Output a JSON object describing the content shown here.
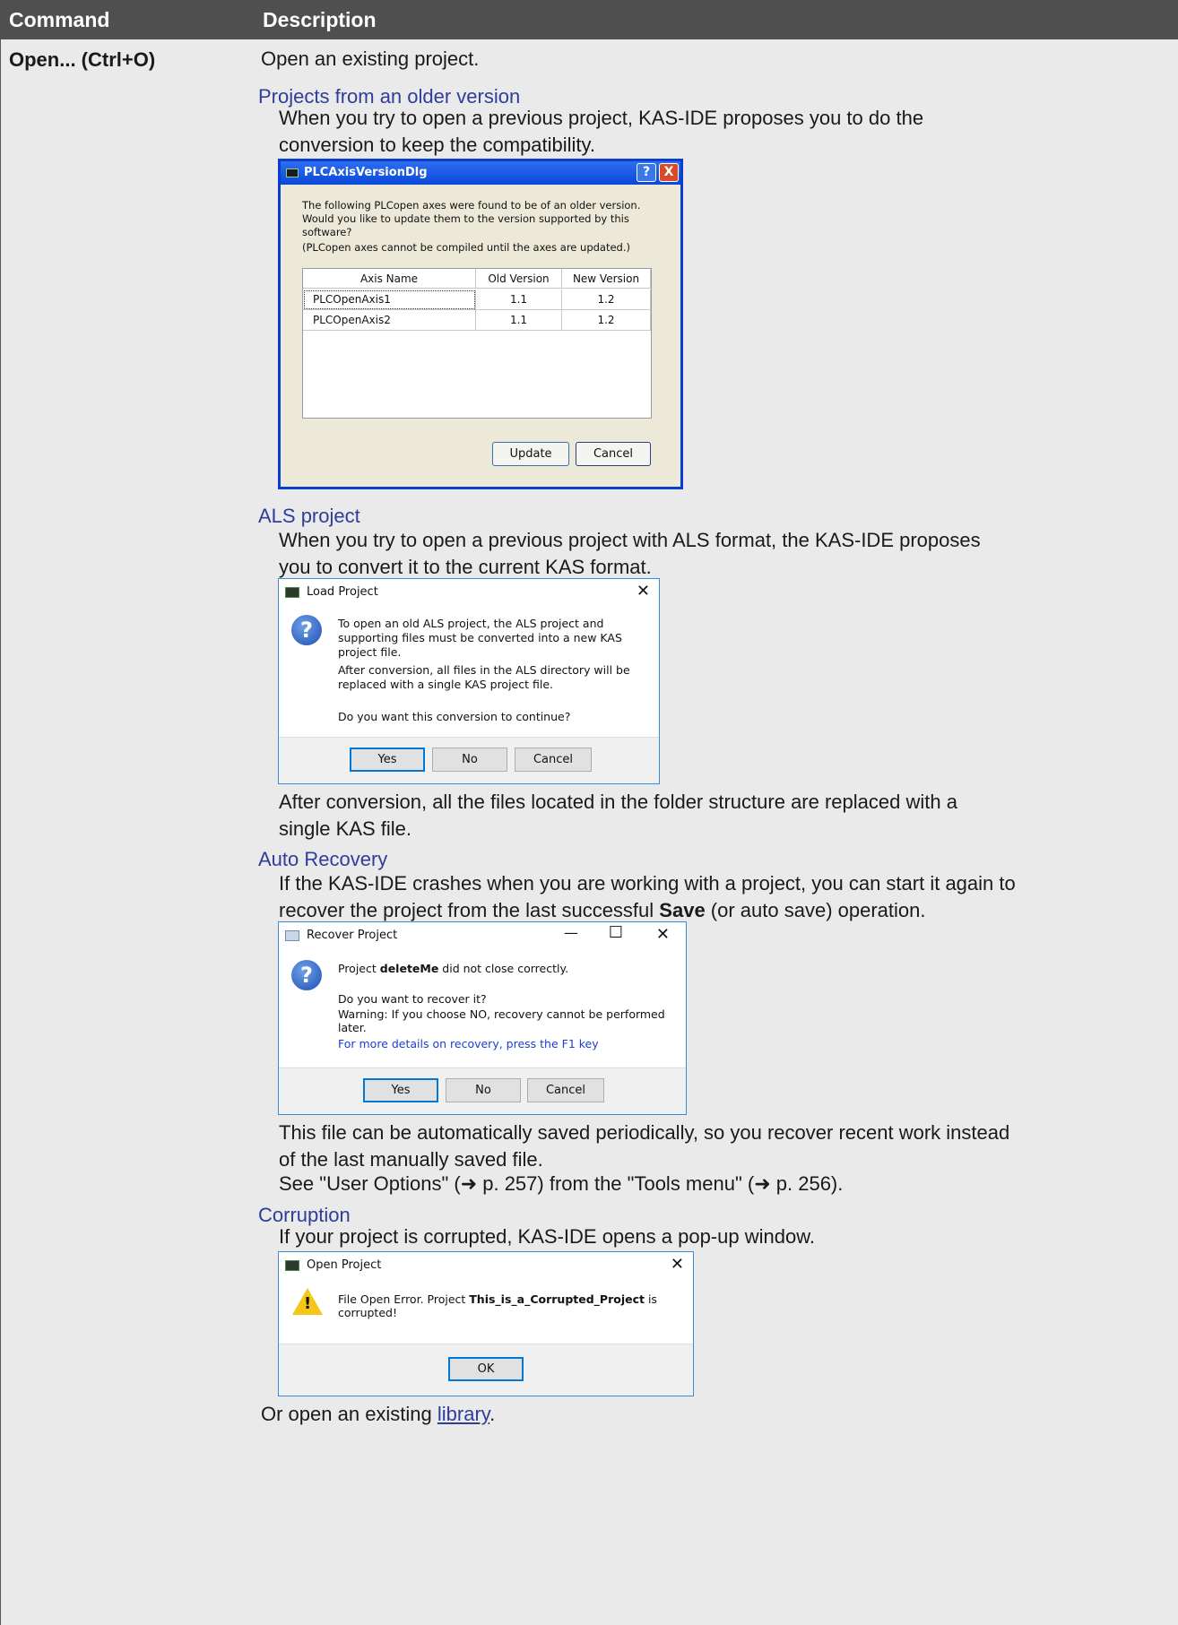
{
  "header": {
    "command": "Command",
    "description": "Description"
  },
  "command_name": "Open... (Ctrl+O)",
  "intro": "Open an existing project.",
  "sections": {
    "older": {
      "heading": "Projects from an older version",
      "text": "When you try to open a previous project, KAS-IDE proposes you to do the conversion to keep the compatibility."
    },
    "als": {
      "heading": "ALS project",
      "text": "When you try to open a previous project with ALS format, the KAS-IDE proposes you to convert it to the current KAS format.",
      "after": "After conversion, all the files located in the folder structure are replaced with a single KAS file."
    },
    "recovery": {
      "heading": "Auto Recovery",
      "text_pre": "If the KAS-IDE crashes when you are working with a project, you can start it again to recover the project from the last successful ",
      "text_bold": "Save",
      "text_post": " (or auto save) operation.",
      "after1": "This file can be automatically saved periodically, so you recover recent work instead of the last manually saved file.",
      "after2": "See \"User Options\" (➜ p. 257) from the \"Tools menu\" (➜ p. 256)."
    },
    "corruption": {
      "heading": "Corruption",
      "text": "If your project is corrupted, KAS-IDE opens a pop-up window."
    }
  },
  "footer": {
    "pre": "Or open an existing ",
    "link": "library",
    "post": "."
  },
  "dialog_axis": {
    "title": "PLCAxisVersionDlg",
    "help": "?",
    "close": "X",
    "msg1": "The following PLCopen axes were found to be of an older version. Would you like to update them to the version supported by this software?",
    "msg2": "(PLCopen axes cannot be compiled until the axes are updated.)",
    "columns": [
      "Axis Name",
      "Old Version",
      "New Version"
    ],
    "rows": [
      [
        "PLCOpenAxis1",
        "1.1",
        "1.2"
      ],
      [
        "PLCOpenAxis2",
        "1.1",
        "1.2"
      ]
    ],
    "update": "Update",
    "cancel": "Cancel"
  },
  "dialog_load": {
    "title": "Load Project",
    "close": "✕",
    "msg1": "To open an old ALS project, the ALS project and supporting files must be converted into a new KAS project file.",
    "msg2": "After conversion, all files in the ALS directory will be replaced with a single KAS project file.",
    "msg3": "Do you want this conversion to continue?",
    "yes": "Yes",
    "no": "No",
    "cancel": "Cancel"
  },
  "dialog_recover": {
    "title": "Recover Project",
    "minimize": "—",
    "maximize": "☐",
    "close": "✕",
    "msg1_pre": "Project ",
    "msg1_bold": "deleteMe",
    "msg1_post": " did not close correctly.",
    "msg2": "Do you want to recover it?",
    "msg3": "Warning: If you choose NO, recovery cannot be performed later.",
    "help_link": "For more details on recovery, press the F1 key",
    "yes": "Yes",
    "no": "No",
    "cancel": "Cancel"
  },
  "dialog_open": {
    "title": "Open Project",
    "close": "✕",
    "msg_pre": "File Open Error. Project ",
    "msg_bold": "This_is_a_Corrupted_Project",
    "msg_post": " is corrupted!",
    "ok": "OK"
  },
  "icons": {
    "question": "?",
    "warning": "!"
  },
  "colors": {
    "header_bg": "#4f4f4f",
    "subheading": "#2e3d9a",
    "body_bg": "#eaeaea"
  }
}
